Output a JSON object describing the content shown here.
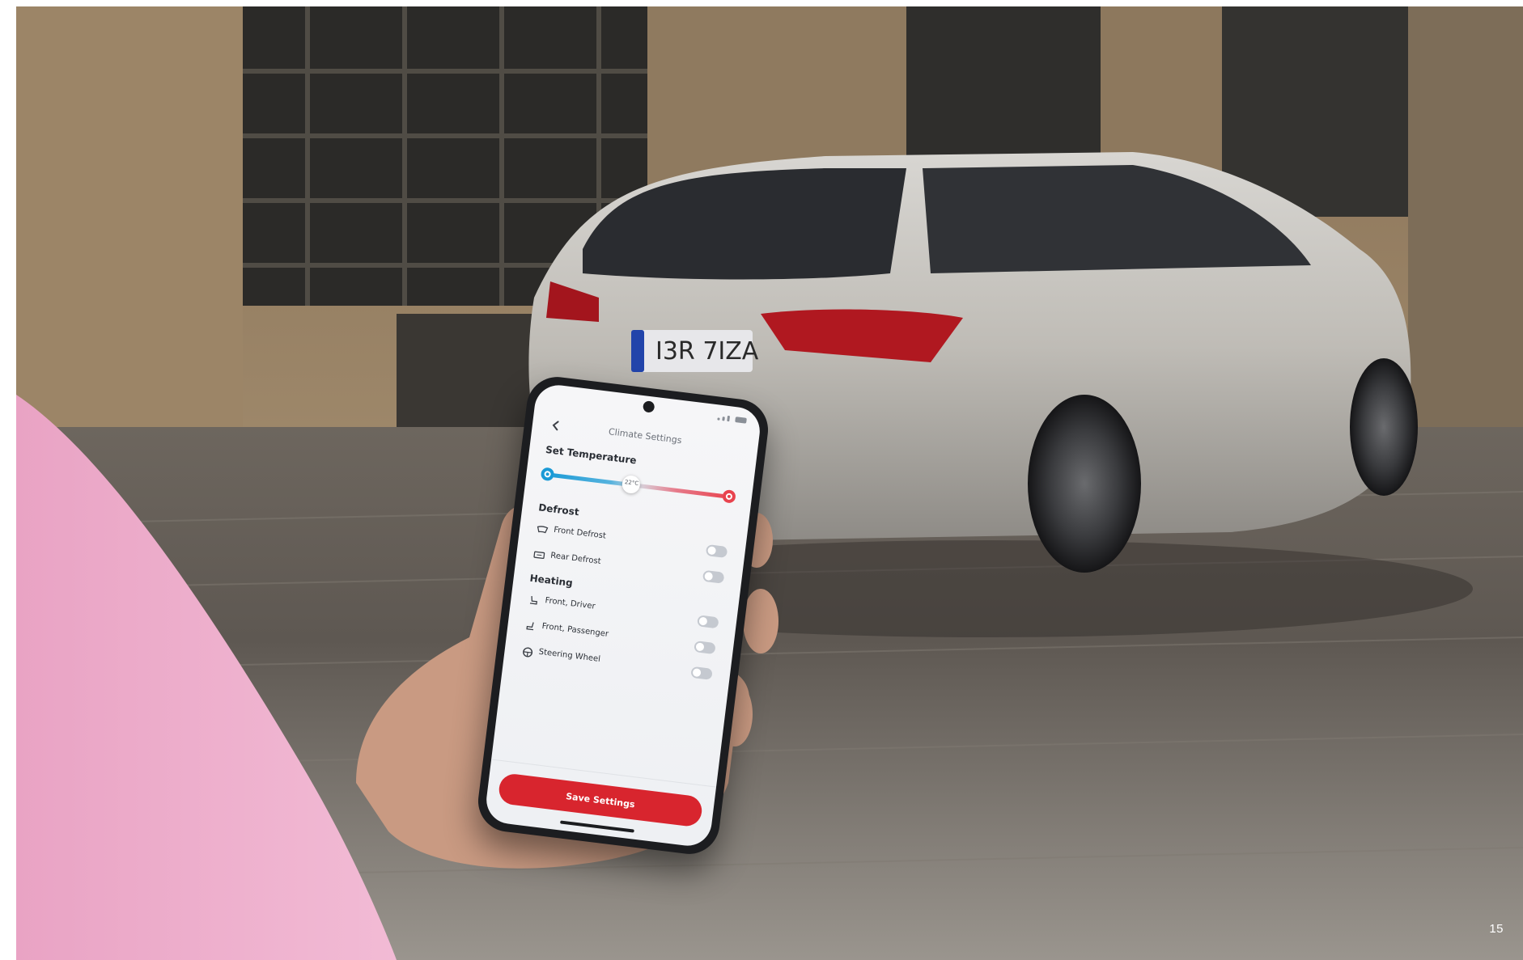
{
  "page": {
    "number": "15"
  },
  "app": {
    "title": "Climate Settings",
    "back_icon": "chevron-left-icon",
    "set_temperature": {
      "label": "Set Temperature",
      "value_label": "22°C",
      "fraction": 0.46,
      "min_icon": "snowflake-icon",
      "max_icon": "heat-icon",
      "colors": {
        "cold": "#1a9ad6",
        "hot": "#e8434e"
      }
    },
    "defrost": {
      "label": "Defrost",
      "items": [
        {
          "label": "Front Defrost",
          "icon": "front-windshield-icon",
          "on": false
        },
        {
          "label": "Rear Defrost",
          "icon": "rear-window-icon",
          "on": false
        }
      ]
    },
    "heating": {
      "label": "Heating",
      "items": [
        {
          "label": "Front, Driver",
          "icon": "seat-icon",
          "on": false
        },
        {
          "label": "Front, Passenger",
          "icon": "seat-icon",
          "on": false
        },
        {
          "label": "Steering Wheel",
          "icon": "steering-wheel-icon",
          "on": false
        }
      ]
    },
    "save_button": {
      "label": "Save Settings",
      "color": "#d8252e"
    }
  }
}
